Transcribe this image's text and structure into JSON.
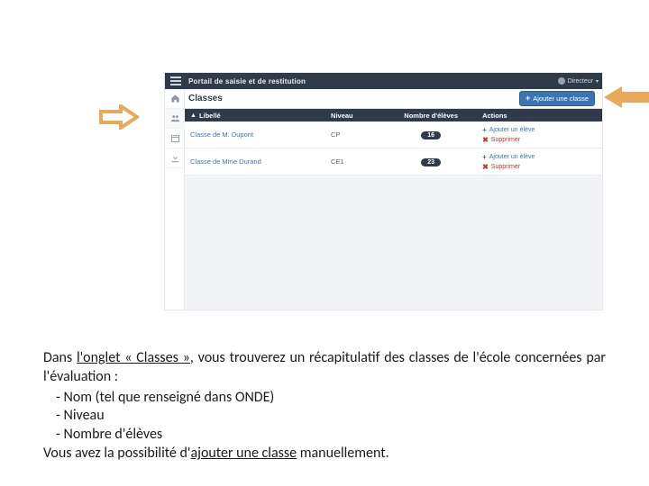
{
  "annotation_arrows": {
    "color_hex": "#e8a95a"
  },
  "screenshot": {
    "topbar": {
      "title": "Portail de saisie et de restitution",
      "user_label": "Directeur"
    },
    "subheader": {
      "title": "Classes",
      "add_button_label": "Ajouter une classe"
    },
    "sidebar": {
      "icons": [
        {
          "name": "home-icon"
        },
        {
          "name": "classes-icon"
        },
        {
          "name": "calendar-icon"
        },
        {
          "name": "download-icon"
        }
      ]
    },
    "table": {
      "columns": {
        "libelle": "Libellé",
        "niveau": "Niveau",
        "nombre": "Nombre d'élèves",
        "actions": "Actions"
      },
      "rows": [
        {
          "libelle": "Classe de M. Dupont",
          "niveau": "CP",
          "nombre": "16",
          "add_label": "Ajouter un élève",
          "del_label": "Supprimer"
        },
        {
          "libelle": "Classe de Mme Durand",
          "niveau": "CE1",
          "nombre": "23",
          "add_label": "Ajouter un élève",
          "del_label": "Supprimer"
        }
      ]
    }
  },
  "caption": {
    "line1_a": "Dans ",
    "line1_b": "l'onglet  « Classes »",
    "line1_c": ", vous trouverez un récapitulatif des classes de l'école concernées par l'évaluation :",
    "bullets": [
      "Nom (tel que renseigné dans ONDE)",
      "Niveau",
      "Nombre d'élèves"
    ],
    "line2_a": "Vous avez la possibilité d'",
    "line2_b": "ajouter une classe",
    "line2_c": " manuellement."
  }
}
